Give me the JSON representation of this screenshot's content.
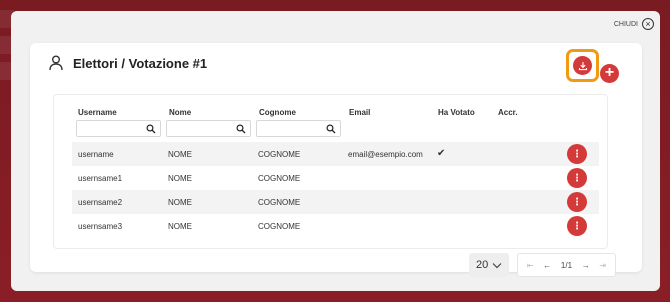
{
  "close_label": "CHIUDI",
  "title": "Elettori / Votazione #1",
  "columns": [
    "Username",
    "Nome",
    "Cognome",
    "Email",
    "Ha Votato",
    "Accr."
  ],
  "rows": [
    {
      "username": "username",
      "nome": "NOME",
      "cognome": "COGNOME",
      "email": "email@esempio.com",
      "voted": "✔"
    },
    {
      "username": "usernsame1",
      "nome": "NOME",
      "cognome": "COGNOME",
      "email": "",
      "voted": ""
    },
    {
      "username": "usernsame2",
      "nome": "NOME",
      "cognome": "COGNOME",
      "email": "",
      "voted": ""
    },
    {
      "username": "usernsame3",
      "nome": "NOME",
      "cognome": "COGNOME",
      "email": "",
      "voted": ""
    }
  ],
  "pagination": {
    "page_size": "20",
    "page_info": "1/1"
  },
  "colors": {
    "accent": "#d53a3a",
    "highlight": "#f29a13",
    "backdrop": "#7d1a1f"
  },
  "icons": [
    "close-icon",
    "user-icon",
    "download-icon",
    "plus-icon",
    "search-icon",
    "more-options-icon",
    "chevron-down-icon",
    "first-page-icon",
    "prev-page-icon",
    "next-page-icon",
    "last-page-icon"
  ]
}
